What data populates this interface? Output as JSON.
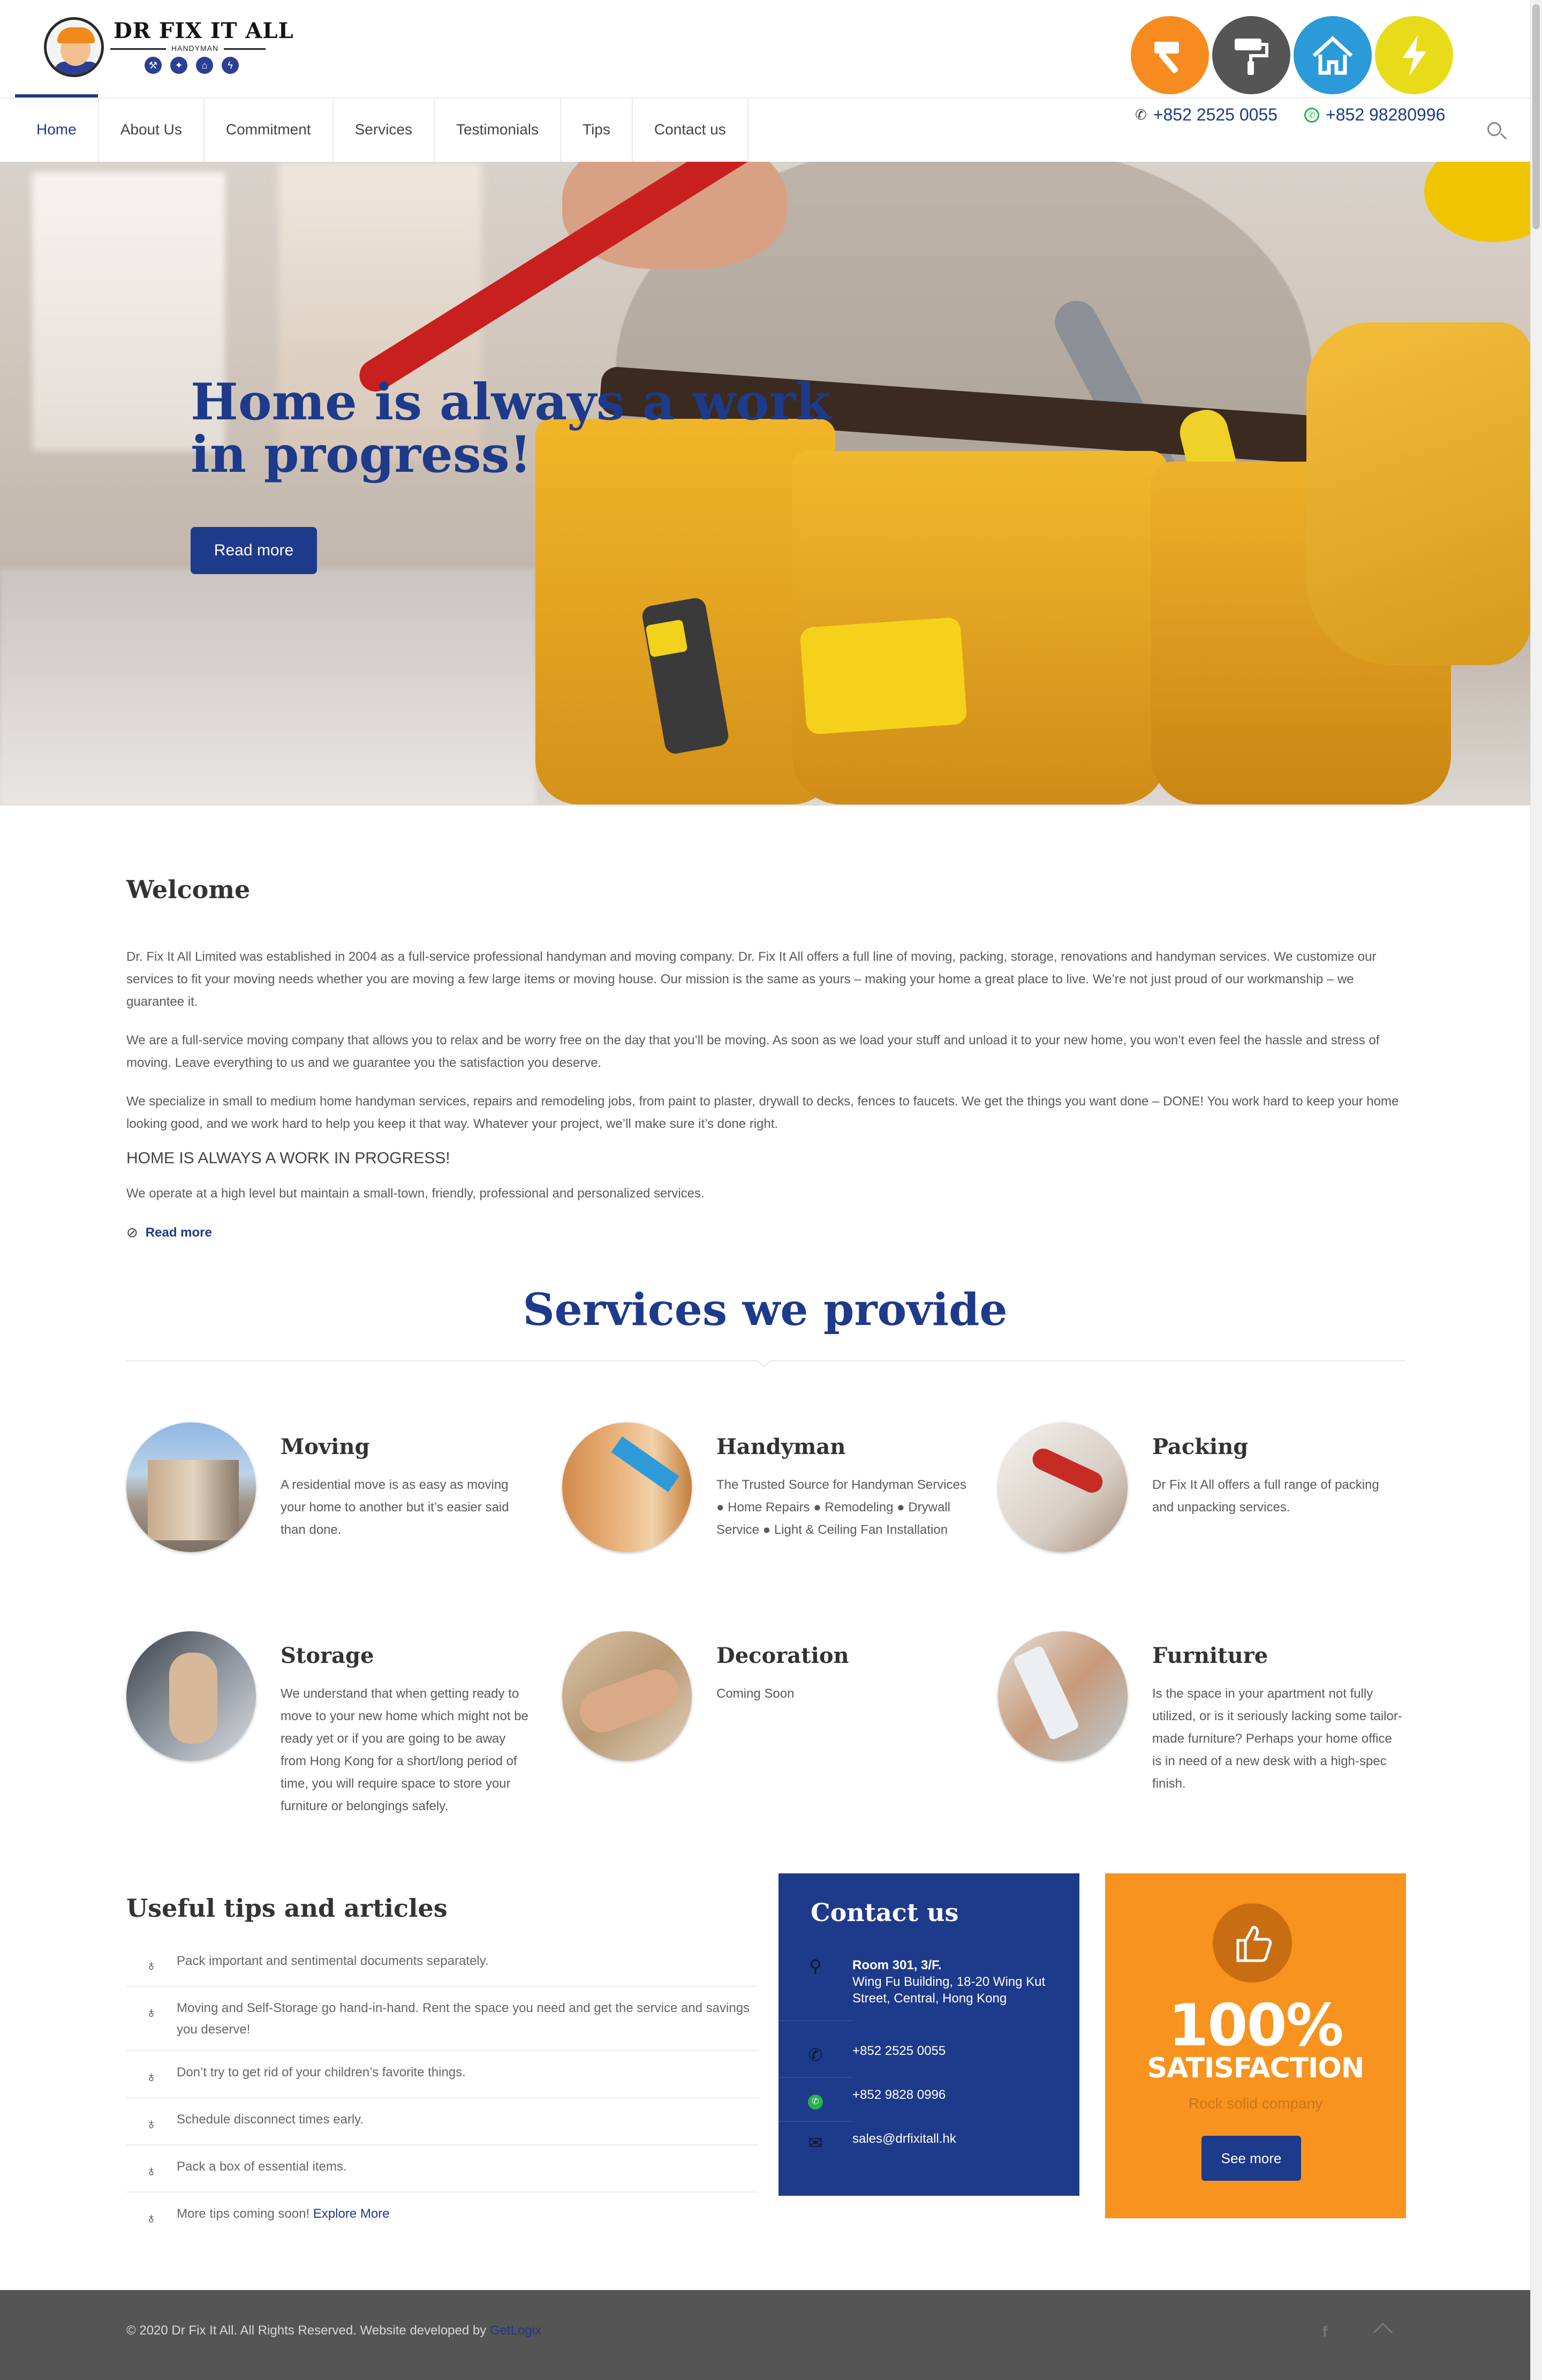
{
  "logo": {
    "title": "DR FIX IT ALL",
    "subtitle": "HANDYMAN"
  },
  "header": {
    "service_icons": [
      "hammer-icon",
      "paint-roller-icon",
      "house-icon",
      "lightning-icon"
    ],
    "phone": "+852 2525 0055",
    "whatsapp": "+852 98280996"
  },
  "nav": {
    "items": [
      {
        "label": "Home",
        "active": true
      },
      {
        "label": "About Us"
      },
      {
        "label": "Commitment"
      },
      {
        "label": "Services"
      },
      {
        "label": "Testimonials"
      },
      {
        "label": "Tips"
      },
      {
        "label": "Contact us"
      }
    ]
  },
  "hero": {
    "title": "Home is always a work in progress!",
    "button": "Read more"
  },
  "welcome": {
    "title": "Welcome",
    "p1": "Dr. Fix It All Limited was established in 2004 as a full-service professional handyman and moving company. Dr. Fix It All offers a full line of moving, packing, storage, renovations and handyman services. We customize our services to fit your moving needs whether you are moving a few large items or moving house. Our mission is the same as yours – making your home a great place to live. We’re not just proud of our workmanship – we guarantee it.",
    "p2": "We are a full-service moving company that allows you to relax and be worry free on the day that you’ll be moving. As soon as we load your stuff and unload it to your new home, you won’t even feel the hassle and stress of moving. Leave everything to us and we guarantee you the satisfaction you deserve.",
    "p3": "We specialize in small to medium home handyman services, repairs and remodeling jobs, from paint to plaster, drywall to decks, fences to faucets. We get the things you want done – DONE! You work hard to keep your home looking good, and we work hard to help you keep it that way. Whatever your project, we’ll make sure it’s done right.",
    "caps": "HOME IS ALWAYS A WORK IN PROGRESS!",
    "p4": "We operate at a high level but maintain a small-town, friendly, professional and personalized services.",
    "read_more": "Read more"
  },
  "services": {
    "title": "Services we provide",
    "items": [
      {
        "title": "Moving",
        "text": "A residential move is as easy as moving your home to another but it’s easier said than done."
      },
      {
        "title": "Handyman",
        "text": "The Trusted Source for Handyman Services ● Home Repairs ● Remodeling ● Drywall Service ● Light & Ceiling Fan Installation"
      },
      {
        "title": "Packing",
        "text": "Dr Fix It All offers a full range of packing and unpacking services."
      },
      {
        "title": "Storage",
        "text": "We understand that when getting ready to move to your new home which might not be ready yet or if you are going to be away from Hong Kong for a short/long period of time, you will require space to store your furniture or belongings safely."
      },
      {
        "title": "Decoration",
        "text": "Coming Soon"
      },
      {
        "title": "Furniture",
        "text": "Is the space in your apartment not fully utilized, or is it seriously lacking some tailor-made furniture? Perhaps your home office is in need of a new desk with a high-spec finish."
      }
    ]
  },
  "tips": {
    "title": "Useful tips and articles",
    "items": [
      "Pack important and sentimental documents separately.",
      "Moving and Self-Storage go hand-in-hand. Rent the space you need and get the service and savings you deserve!",
      "Don’t try to get rid of your children’s favorite things.",
      "Schedule disconnect times early.",
      "Pack a box of essential items."
    ],
    "last_prefix": "More tips coming soon!",
    "last_link": "Explore More"
  },
  "contact": {
    "title": "Contact us",
    "address_bold": "Room 301, 3/F.",
    "address_rest": "Wing Fu Building, 18-20 Wing Kut Street, Central, Hong Kong",
    "phone": "+852 2525 0055",
    "whatsapp": "+852 9828 0996",
    "email": "sales@drfixitall.hk"
  },
  "satisfaction": {
    "big": "100%",
    "sub": "SATISFACTION",
    "tagline": "Rock solid company",
    "button": "See more"
  },
  "footer": {
    "text": "© 2020 Dr Fix It All. All Rights Reserved. Website developed by",
    "link": "GetLogix"
  },
  "colors": {
    "brand_blue": "#1e3a8a",
    "orange": "#f7931e",
    "footer": "#555555"
  }
}
